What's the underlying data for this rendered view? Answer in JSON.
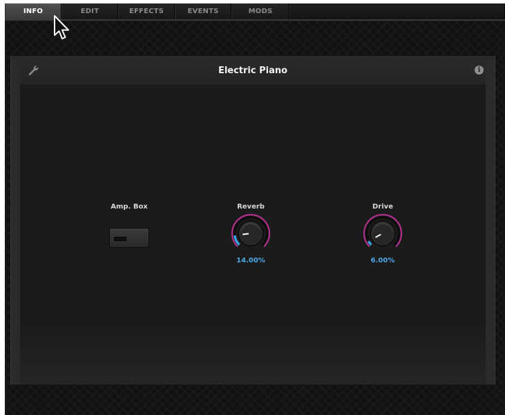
{
  "tabs": [
    {
      "label": "INFO",
      "active": true
    },
    {
      "label": "EDIT",
      "active": false
    },
    {
      "label": "EFFECTS",
      "active": false
    },
    {
      "label": "EVENTS",
      "active": false
    },
    {
      "label": "MODS",
      "active": false
    }
  ],
  "panel": {
    "title": "Electric Piano",
    "left_icon": "wrench-icon",
    "right_icon": "info-icon",
    "info_glyph": "i"
  },
  "controls": {
    "ampbox": {
      "label": "Amp. Box",
      "type": "toggle",
      "on": false
    },
    "reverb": {
      "label": "Reverb",
      "value_text": "14.00%",
      "value": 0.14
    },
    "drive": {
      "label": "Drive",
      "value_text": "6.00%",
      "value": 0.06
    }
  },
  "colors": {
    "value_text": "#4aa6e6",
    "knob_ring": "#b0308c",
    "knob_fill": "#3aa0e0"
  }
}
